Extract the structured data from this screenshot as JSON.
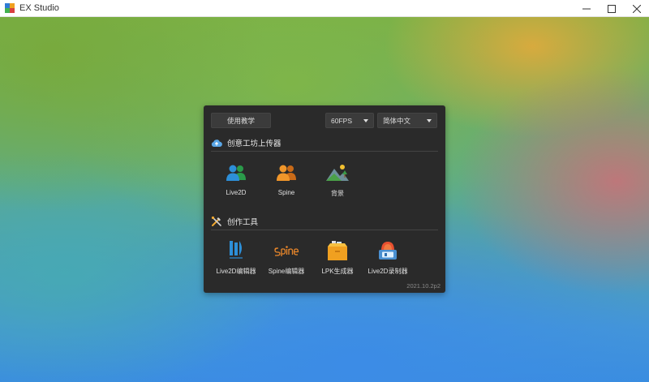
{
  "window": {
    "title": "EX Studio",
    "controls": {
      "minimize": "—",
      "maximize": "☐",
      "close": "✕"
    }
  },
  "panel": {
    "tutorial_label": "使用教学",
    "fps_select": {
      "value": "60FPS"
    },
    "language_select": {
      "value": "简体中文"
    },
    "uploader_section": {
      "title": "创意工坊上传器",
      "icon": "cloud-upload-icon",
      "items": [
        {
          "label": "Live2D",
          "icon": "live2d-users-icon"
        },
        {
          "label": "Spine",
          "icon": "spine-users-icon"
        },
        {
          "label": "背景",
          "icon": "landscape-icon"
        }
      ]
    },
    "tools_section": {
      "title": "创作工具",
      "icon": "tools-icon",
      "items": [
        {
          "label": "Live2D编辑器",
          "icon": "live2d-logo-icon"
        },
        {
          "label": "Spine编辑器",
          "icon": "spine-logo-icon"
        },
        {
          "label": "LPK生成器",
          "icon": "box-icon"
        },
        {
          "label": "Live2D录制器",
          "icon": "recorder-icon"
        }
      ]
    },
    "version": "2021.10.2p2"
  },
  "colors": {
    "panel_bg": "#2a2a2a",
    "accent_blue": "#2d8fd8",
    "accent_orange": "#e8862a"
  }
}
